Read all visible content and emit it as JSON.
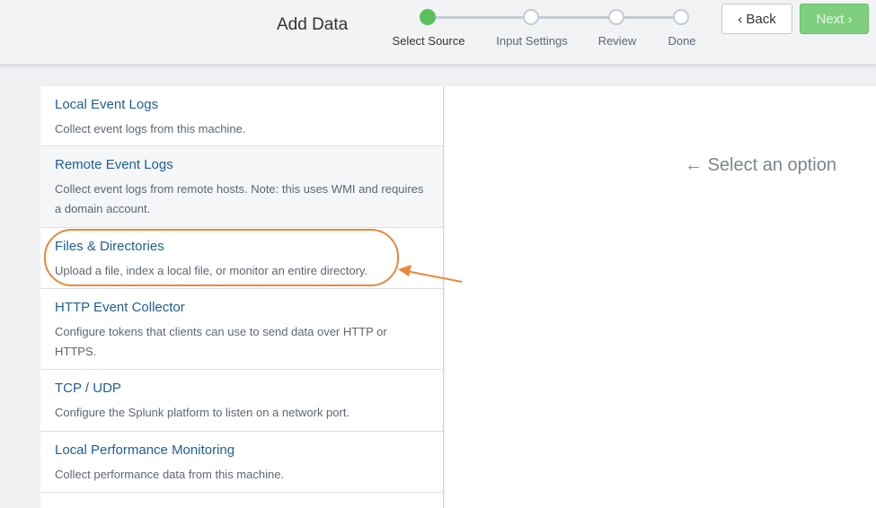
{
  "header": {
    "title": "Add Data",
    "back_label": "Back",
    "next_label": "Next",
    "steps": [
      {
        "label": "Select Source",
        "active": true
      },
      {
        "label": "Input Settings",
        "active": false
      },
      {
        "label": "Review",
        "active": false
      },
      {
        "label": "Done",
        "active": false
      }
    ]
  },
  "sources": [
    {
      "name": "Local Event Logs",
      "desc": "Collect event logs from this machine."
    },
    {
      "name": "Remote Event Logs",
      "desc": "Collect event logs from remote hosts. Note: this uses WMI and requires a domain account."
    },
    {
      "name": "Files & Directories",
      "desc": "Upload a file, index a local file, or monitor an entire directory."
    },
    {
      "name": "HTTP Event Collector",
      "desc": "Configure tokens that clients can use to send data over HTTP or HTTPS."
    },
    {
      "name": "TCP / UDP",
      "desc": "Configure the Splunk platform to listen on a network port."
    },
    {
      "name": "Local Performance Monitoring",
      "desc": "Collect performance data from this machine."
    }
  ],
  "main": {
    "prompt": "Select an option"
  },
  "colors": {
    "accent": "#5cc05c",
    "annotation": "#e8883a",
    "link": "#1e5f94"
  }
}
